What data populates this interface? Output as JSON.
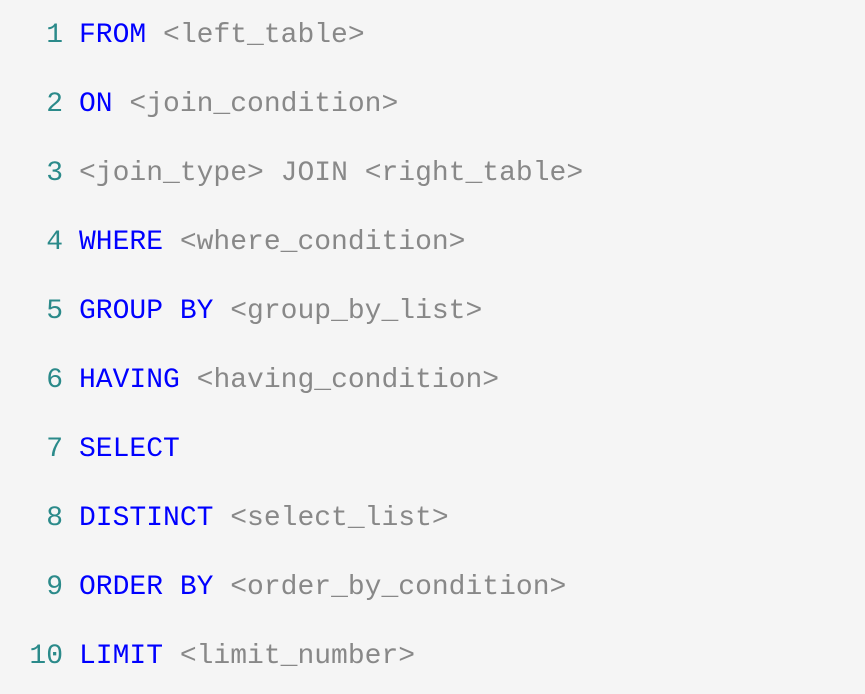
{
  "lines": [
    {
      "num": "1",
      "tokens": [
        {
          "type": "keyword",
          "text": "FROM"
        },
        {
          "type": "space",
          "text": " "
        },
        {
          "type": "placeholder",
          "text": "<left_table>"
        }
      ]
    },
    {
      "num": "2",
      "tokens": [
        {
          "type": "keyword",
          "text": "ON"
        },
        {
          "type": "space",
          "text": " "
        },
        {
          "type": "placeholder",
          "text": "<join_condition>"
        }
      ]
    },
    {
      "num": "3",
      "tokens": [
        {
          "type": "placeholder",
          "text": "<join_type>"
        },
        {
          "type": "space",
          "text": " "
        },
        {
          "type": "join-keyword",
          "text": "JOIN"
        },
        {
          "type": "space",
          "text": " "
        },
        {
          "type": "placeholder",
          "text": "<right_table>"
        }
      ]
    },
    {
      "num": "4",
      "tokens": [
        {
          "type": "keyword",
          "text": "WHERE"
        },
        {
          "type": "space",
          "text": " "
        },
        {
          "type": "placeholder",
          "text": "<where_condition>"
        }
      ]
    },
    {
      "num": "5",
      "tokens": [
        {
          "type": "keyword",
          "text": "GROUP"
        },
        {
          "type": "space",
          "text": " "
        },
        {
          "type": "keyword",
          "text": "BY"
        },
        {
          "type": "space",
          "text": " "
        },
        {
          "type": "placeholder",
          "text": "<group_by_list>"
        }
      ]
    },
    {
      "num": "6",
      "tokens": [
        {
          "type": "keyword",
          "text": "HAVING"
        },
        {
          "type": "space",
          "text": " "
        },
        {
          "type": "placeholder",
          "text": "<having_condition>"
        }
      ]
    },
    {
      "num": "7",
      "tokens": [
        {
          "type": "keyword",
          "text": "SELECT"
        }
      ]
    },
    {
      "num": "8",
      "tokens": [
        {
          "type": "keyword",
          "text": "DISTINCT"
        },
        {
          "type": "space",
          "text": " "
        },
        {
          "type": "placeholder",
          "text": "<select_list>"
        }
      ]
    },
    {
      "num": "9",
      "tokens": [
        {
          "type": "keyword",
          "text": "ORDER"
        },
        {
          "type": "space",
          "text": " "
        },
        {
          "type": "keyword",
          "text": "BY"
        },
        {
          "type": "space",
          "text": " "
        },
        {
          "type": "placeholder",
          "text": "<order_by_condition>"
        }
      ]
    },
    {
      "num": "10",
      "tokens": [
        {
          "type": "keyword",
          "text": "LIMIT"
        },
        {
          "type": "space",
          "text": " "
        },
        {
          "type": "placeholder",
          "text": "<limit_number>"
        }
      ]
    }
  ]
}
